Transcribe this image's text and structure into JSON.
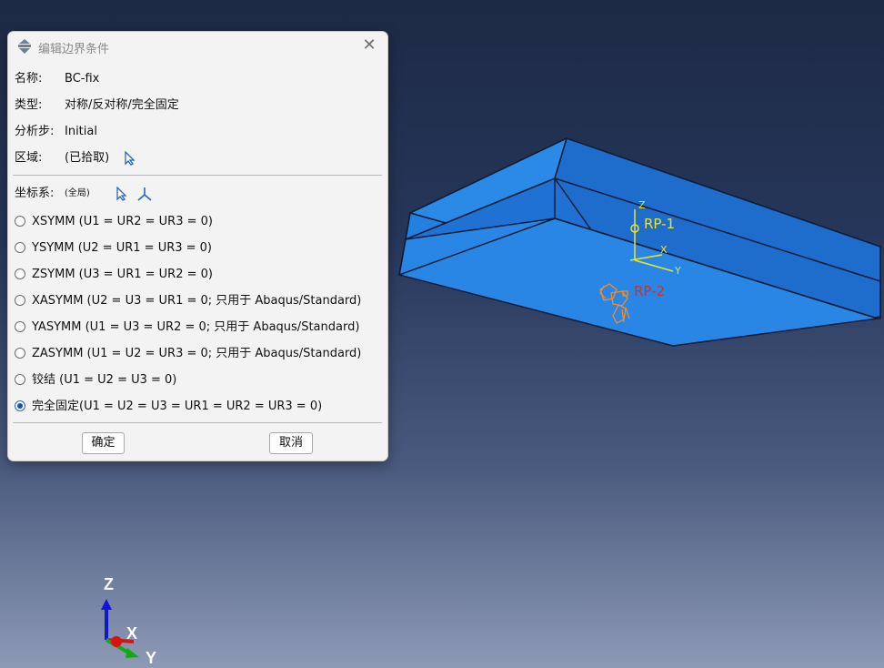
{
  "dialog": {
    "title": "编辑边界条件",
    "name_label": "名称:",
    "name_value": "BC-fix",
    "type_label": "类型:",
    "type_value": "对称/反对称/完全固定",
    "step_label": "分析步:",
    "step_value": "Initial",
    "region_label": "区域:",
    "region_value": "(已拾取)",
    "csys_label": "坐标系:",
    "csys_value": "(全局)",
    "options": [
      {
        "label": "XSYMM (U1 = UR2 = UR3 = 0)",
        "selected": false
      },
      {
        "label": "YSYMM (U2 = UR1 = UR3 = 0)",
        "selected": false
      },
      {
        "label": "ZSYMM (U3 = UR1 = UR2 = 0)",
        "selected": false
      },
      {
        "label": "XASYMM (U2 = U3 = UR1 = 0; 只用于 Abaqus/Standard)",
        "selected": false
      },
      {
        "label": "YASYMM (U1 = U3 = UR2 = 0; 只用于 Abaqus/Standard)",
        "selected": false
      },
      {
        "label": "ZASYMM (U1 = U2 = UR3 = 0; 只用于 Abaqus/Standard)",
        "selected": false
      },
      {
        "label": "铰结 (U1 = U2 = U3 = 0)",
        "selected": false
      },
      {
        "label": "完全固定(U1 = U2 = U3 = UR1 = UR2 = UR3 = 0)",
        "selected": true
      }
    ],
    "ok_label": "确定",
    "cancel_label": "取消"
  },
  "viewport": {
    "rp1_label": "RP-1",
    "rp2_label": "RP-2",
    "local_z": "Z",
    "local_x": "X",
    "local_y": "Y",
    "triad_z": "Z",
    "triad_x": "X",
    "triad_y": "Y",
    "colors": {
      "part_top": "#2d8fe8",
      "part_side": "#1f6ed0",
      "rp1": "#e6e62e",
      "rp2": "#cc2f2f",
      "marker": "#ff8c1a"
    }
  }
}
